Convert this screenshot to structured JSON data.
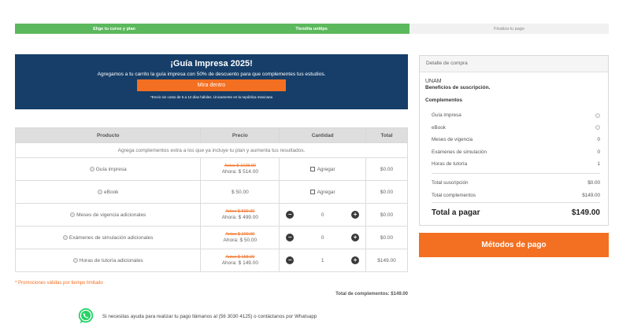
{
  "steps": [
    {
      "label": "Elige tu curso y plan"
    },
    {
      "label": "Tiendita unitips"
    },
    {
      "label": "Finaliza tu pago"
    }
  ],
  "promo": {
    "title": "¡Guía Impresa 2025!",
    "text": "Agregamos a tu carrito la guía impresa con 50% de descuento para que complementes tus estudios.",
    "button": "Mira dentro",
    "note": "*Envío sin costo de 5 a 12 días hábiles. Únicamente en la república mexicana"
  },
  "table": {
    "headers": [
      "Producto",
      "Precio",
      "Cantidad",
      "Total"
    ],
    "subheader": "Agrega complementos extra a los que ya incluye tu plan y aumenta tus resultados.",
    "rows": [
      {
        "name": "Guía impresa",
        "old_price": "Antes $ 1028.00",
        "price": "Ahora: $ 514.00",
        "action": "Agregar",
        "total": "$0.00"
      },
      {
        "name": "eBook",
        "price": "$ 50.00",
        "action": "Agregar",
        "total": "$0.00"
      },
      {
        "name": "Meses de vigencia adicionales",
        "old_price": "Antes $ 599.00",
        "price": "Ahora: $ 499.00",
        "qty": "0",
        "total": "$0.00"
      },
      {
        "name": "Exámenes de simulación adicionales",
        "old_price": "Antes $ 100.00",
        "price": "Ahora: $ 50.00",
        "qty": "0",
        "total": "$0.00"
      },
      {
        "name": "Horas de tutoría adicionales",
        "old_price": "Antes $ 158.00",
        "price": "Ahora: $ 149.00",
        "qty": "1",
        "total": "$149.00"
      }
    ]
  },
  "promo_valid": "* Promociones válidas por tiempo limitado",
  "total_complementos": "Total de complementos: $149.00",
  "help_text": "Si necesitas ayuda para realizar tu pago llámanos al (56 3030 4125) o contáctanos por Whatsapp",
  "summary": {
    "header": "Detalle de compra",
    "plan": "UNAM",
    "plan_desc": "Beneficios de suscripción.",
    "complementos_label": "Complementos",
    "items": [
      {
        "label": "Guía impresa"
      },
      {
        "label": "eBook"
      },
      {
        "label": "Meses de vigencia",
        "value": "0"
      },
      {
        "label": "Exámenes de simulación",
        "value": "0"
      },
      {
        "label": "Horas de tutoría",
        "value": "1"
      }
    ],
    "total_suscripcion_label": "Total suscripción",
    "total_suscripcion": "$0.00",
    "total_complementos_label": "Total complementos",
    "total_complementos": "$149.00",
    "total_label": "Total a pagar",
    "total": "$149.00"
  },
  "pay_button": "Métodos de pago",
  "colors": {
    "accent": "#f36f21",
    "banner": "#163e68",
    "step_done": "#5cb85c",
    "whatsapp": "#25d366"
  }
}
